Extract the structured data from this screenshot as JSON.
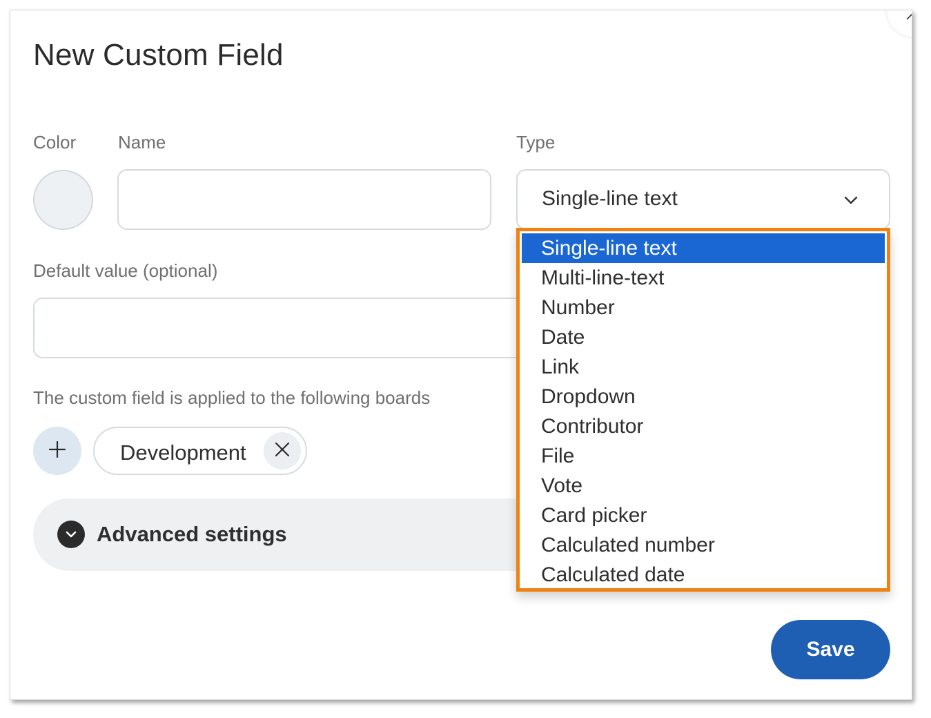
{
  "dialog": {
    "title": "New Custom Field"
  },
  "form": {
    "color_label": "Color",
    "name_label": "Name",
    "name_value": "",
    "type_label": "Type",
    "type_value": "Single-line text",
    "default_label": "Default value (optional)",
    "default_value": "",
    "boards_helper": "The custom field is applied to the following boards",
    "boards": [
      {
        "label": "Development"
      }
    ],
    "advanced_label": "Advanced settings",
    "save_label": "Save"
  },
  "type_dropdown": {
    "selected_index": 0,
    "options": [
      "Single-line text",
      "Multi-line-text",
      "Number",
      "Date",
      "Link",
      "Dropdown",
      "Contributor",
      "File",
      "Vote",
      "Card picker",
      "Calculated number",
      "Calculated date"
    ]
  },
  "colors": {
    "primary": "#1f5fb3",
    "selected_option": "#1a67d4",
    "highlight_border": "#f08212",
    "color_swatch": "#eef1f4"
  },
  "icons": {
    "type_chevron": "chevron-down-icon",
    "add_board": "plus-icon",
    "remove_board": "close-icon",
    "advanced_toggle": "chevron-down-circle-icon"
  }
}
